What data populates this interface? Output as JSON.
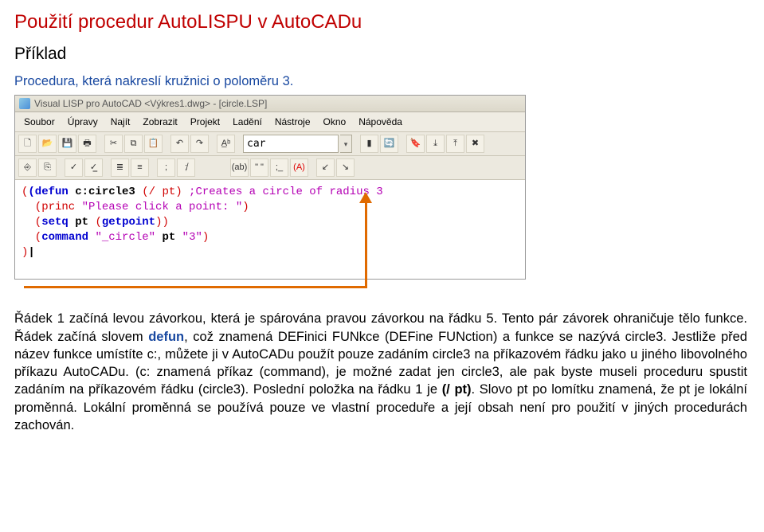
{
  "title": "Použití procedur AutoLISPU v AutoCADu",
  "subtitle": "Příklad",
  "intro": "Procedura, která nakreslí kružnici o poloměru 3.",
  "window": {
    "title": "Visual LISP pro AutoCAD <Výkres1.dwg> - [circle.LSP]",
    "menu": {
      "soubor": "Soubor",
      "upravy": "Úpravy",
      "najit": "Najít",
      "zobrazit": "Zobrazit",
      "projekt": "Projekt",
      "ladeni": "Ladění",
      "nastroje": "Nástroje",
      "okno": "Okno",
      "napoveda": "Nápověda"
    },
    "find_value": "car"
  },
  "code": {
    "l1_kw": "(defun ",
    "l1_name": "c:circle3 ",
    "l1_args": "(/ pt) ",
    "l1_comment": ";Creates a circle of radius 3",
    "l2_a": "  (princ ",
    "l2_str": "\"Please click a point: \"",
    "l2_b": ")",
    "l3_a": "  (setq ",
    "l3_b": "pt ",
    "l3_c": "(getpoint))",
    "l4_a": "  (command ",
    "l4_str": "\"_circle\"",
    "l4_b": " pt ",
    "l4_str2": "\"3\"",
    "l4_c": ")",
    "l5": ")|"
  },
  "toolbar_icons": {
    "new": "🗋",
    "open": "📂",
    "save": "💾",
    "print": "🖶",
    "cut": "✂",
    "copy": "⧉",
    "paste": "📋",
    "undo": "↶",
    "redo": "↷",
    "bookmark": "▮",
    "complete": "A̲ᵇ",
    "run": "⌦",
    "load": "⬇",
    "check": "✔",
    "format": "≣",
    "comment": "//",
    "help": "?"
  },
  "toolbar2_icons": {
    "i1": "⎙",
    "i2": "⎘",
    "i3": "⎚",
    "i4": "⦾",
    "i5": "(ab)",
    "i6": "\" \"",
    "i7": ";_",
    "i8": "(A)",
    "i9": "↙",
    "i10": "↘"
  },
  "paragraph": {
    "p1a": "Řádek 1 začíná levou závorkou, která je spárována pravou závorkou na řádku 5. Tento pár závorek ohraničuje tělo funkce. Řádek začíná slovem ",
    "p1_defun": "defun",
    "p1b": ", což znamená DEFinici FUNkce (DEFine FUNction) a funkce se nazývá circle3. Jestliže před název funkce umístíte c:, můžete ji v AutoCADu použít pouze zadáním circle3 na příkazovém řádku jako u jiného libovolného příkazu AutoCADu. (c: znamená příkaz (command), je možné zadat jen circle3, ale pak byste museli proceduru spustit zadáním na příkazovém řádku (circle3). Poslední položka na řádku 1 je ",
    "p1_pt": "(/ pt)",
    "p1c": ". Slovo pt po lomítku znamená, že pt je lokální proměnná. Lokální proměnná se používá pouze ve vlastní proceduře a její obsah není pro použití v jiných procedurách zachován."
  }
}
